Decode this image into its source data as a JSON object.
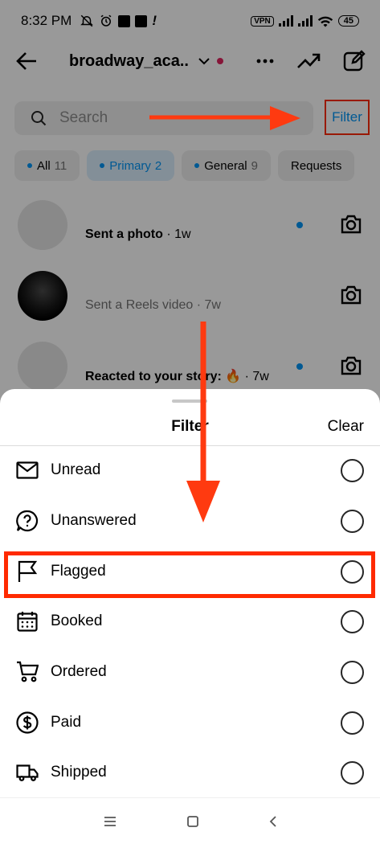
{
  "statusbar": {
    "time": "8:32 PM",
    "vpn": "VPN",
    "battery": "45"
  },
  "header": {
    "username": "broadway_aca..."
  },
  "search": {
    "placeholder": "Search",
    "filter_label": "Filter"
  },
  "chips": [
    {
      "label": "All",
      "count": "11"
    },
    {
      "label": "Primary",
      "count": "2"
    },
    {
      "label": "General",
      "count": "9"
    },
    {
      "label": "Requests"
    }
  ],
  "conversations": [
    {
      "preview": "Sent a photo",
      "time": "1w"
    },
    {
      "preview": "Sent a Reels video",
      "time": "7w"
    },
    {
      "preview": "Reacted to your story: 🔥",
      "time": "7w"
    }
  ],
  "sheet": {
    "title": "Filter",
    "clear": "Clear",
    "options": [
      {
        "label": "Unread",
        "icon": "envelope-icon"
      },
      {
        "label": "Unanswered",
        "icon": "question-bubble-icon"
      },
      {
        "label": "Flagged",
        "icon": "flag-icon"
      },
      {
        "label": "Booked",
        "icon": "calendar-icon"
      },
      {
        "label": "Ordered",
        "icon": "cart-icon"
      },
      {
        "label": "Paid",
        "icon": "dollar-icon"
      },
      {
        "label": "Shipped",
        "icon": "truck-icon"
      }
    ]
  },
  "colors": {
    "accent": "#0095f6",
    "annotation": "#ff2a00",
    "unread_dot": "#e0245e"
  }
}
